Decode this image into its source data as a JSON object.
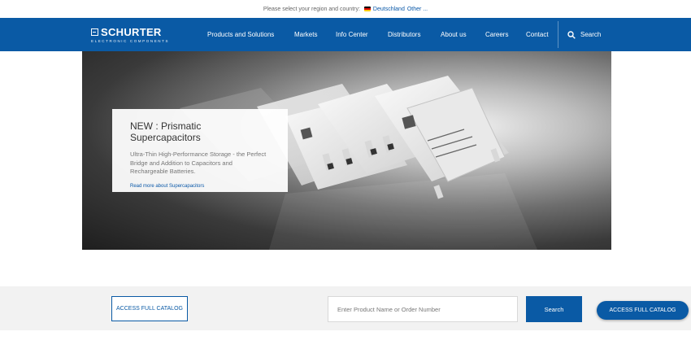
{
  "topbar": {
    "prompt": "Please select your region and country:",
    "country": "Deutschland",
    "other": "Other ..."
  },
  "logo": {
    "brand": "SCHURTER",
    "tagline": "ELECTRONIC COMPONENTS"
  },
  "nav": {
    "items": [
      "Products and Solutions",
      "Markets",
      "Info Center",
      "Distributors",
      "About us",
      "Careers",
      "Contact"
    ],
    "search_label": "Search"
  },
  "hero": {
    "title": "NEW : Prismatic Supercapacitors",
    "body": "Ultra-Thin High-Performance Storage - the Perfect Bridge and Addition to Capacitors and Rechargeable Batteries.",
    "link": "Read more about Supercapacitors"
  },
  "catalog_bar": {
    "access_catalog_label": "ACCESS FULL CATALOG",
    "search_placeholder": "Enter Product Name or Order Number",
    "search_button": "Search",
    "floating_catalog_label": "ACCESS FULL CATALOG"
  },
  "colors": {
    "brand_blue": "#0a5aa5",
    "band_gray": "#f2f2f2"
  },
  "icons": [
    "search-icon",
    "flag-de-icon",
    "schurter-logo-icon"
  ]
}
